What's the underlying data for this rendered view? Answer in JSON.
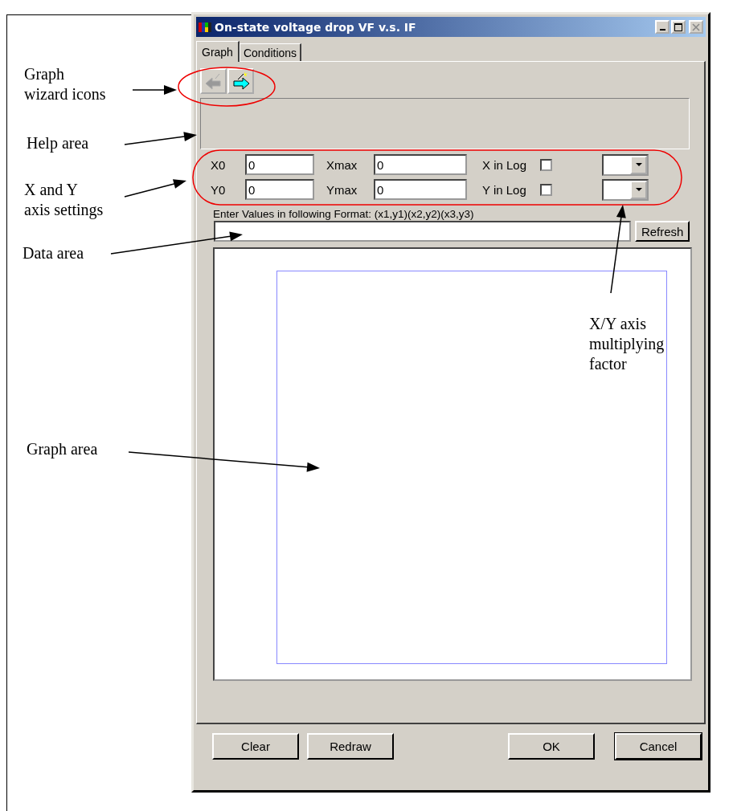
{
  "window": {
    "title": "On-state voltage drop VF v.s. IF"
  },
  "tabs": [
    {
      "label": "Graph",
      "selected": true
    },
    {
      "label": "Conditions",
      "selected": false
    }
  ],
  "wizard_buttons": [
    {
      "kind": "back",
      "disabled": true
    },
    {
      "kind": "next",
      "disabled": false
    }
  ],
  "axis_settings": [
    {
      "min_label": "X0",
      "min_value": "0",
      "max_label": "Xmax",
      "max_value": "0",
      "log_label": "X in Log",
      "log_checked": false
    },
    {
      "min_label": "Y0",
      "min_value": "0",
      "max_label": "Ymax",
      "max_value": "0",
      "log_label": "Y in Log",
      "log_checked": false
    }
  ],
  "data_hint": "Enter Values in following Format:  (x1,y1)(x2,y2)(x3,y3)",
  "refresh_button": "Refresh",
  "buttons": [
    {
      "label": "Clear",
      "default": false
    },
    {
      "label": "Redraw",
      "default": false
    },
    {
      "label": "OK",
      "default": false
    },
    {
      "label": "Cancel",
      "default": true
    }
  ],
  "annotations": [
    {
      "text": "Graph\nwizard icons"
    },
    {
      "text": "Help area"
    },
    {
      "text": "X and Y\naxis settings"
    },
    {
      "text": "Data area"
    },
    {
      "text": "X/Y axis\nmultiplying\nfactor"
    },
    {
      "text": "Graph area"
    }
  ]
}
